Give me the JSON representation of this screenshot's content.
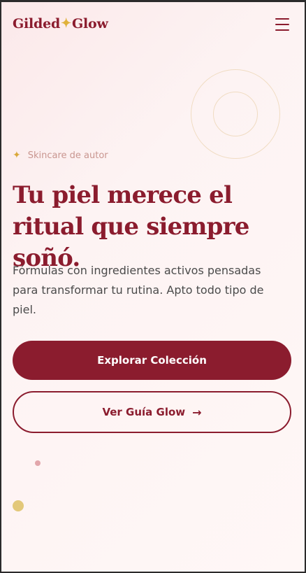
{
  "header": {
    "brand_part1": "Gilded",
    "brand_separator": "✦",
    "brand_part2": "Glow",
    "menu_icon": "hamburger-menu-icon"
  },
  "hero": {
    "eyebrow_icon": "sparkle-icon",
    "eyebrow": "Skincare de autor",
    "headline": "Tu piel merece el ritual que siempre soñó.",
    "description": "Fórmulas con ingredientes activos pensadas para transformar tu rutina. Apto todo tipo de piel.",
    "primary_cta": "Explorar Colección",
    "secondary_cta": "Ver Guía Glow",
    "secondary_cta_icon": "→"
  },
  "colors": {
    "brand": "#8b1c2e",
    "accent_gold": "#e0b13a",
    "muted_rose": "#c99690",
    "background": "#fdf3f3"
  }
}
